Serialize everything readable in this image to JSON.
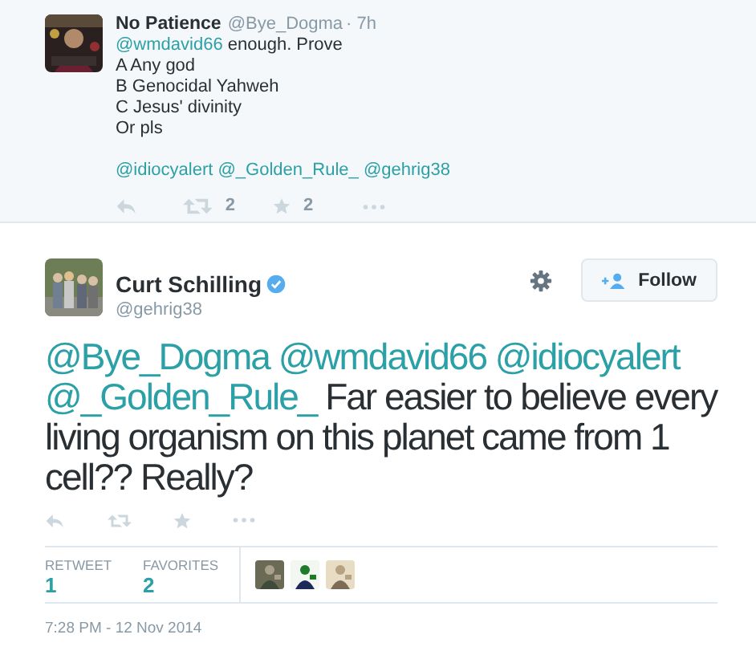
{
  "reply_tweet": {
    "name": "No Patience",
    "handle": "@Bye_Dogma",
    "time": "· 7h",
    "paragraphs": [
      [
        [
          {
            "kind": "mention",
            "text": "@wmdavid66"
          },
          {
            "kind": "text",
            "text": " enough. Prove"
          }
        ],
        [
          {
            "kind": "text",
            "text": "A Any god"
          }
        ],
        [
          {
            "kind": "text",
            "text": "B Genocidal Yahweh"
          }
        ],
        [
          {
            "kind": "text",
            "text": "C Jesus' divinity"
          }
        ],
        [
          {
            "kind": "text",
            "text": "Or pls"
          }
        ]
      ],
      [
        [
          {
            "kind": "mention",
            "text": "@idiocyalert"
          },
          {
            "kind": "mention",
            "text": "@_Golden_Rule_"
          },
          {
            "kind": "mention",
            "text": "@gehrig38"
          }
        ]
      ]
    ],
    "retweets": "2",
    "favorites": "2"
  },
  "main_tweet": {
    "name": "Curt Schilling",
    "verified": true,
    "handle": "@gehrig38",
    "follow_label": "Follow",
    "segments": [
      {
        "kind": "mention",
        "text": "@Bye_Dogma"
      },
      {
        "kind": "mention",
        "text": "@wmdavid66"
      },
      {
        "kind": "mention",
        "text": "@idiocyalert"
      },
      {
        "kind": "mention",
        "text": "@_Golden_Rule_"
      },
      {
        "kind": "text",
        "text": " Far easier to believe every living organism on this planet came from 1 cell?? Really?"
      }
    ],
    "stats": [
      {
        "label": "RETWEET",
        "value": "1"
      },
      {
        "label": "FAVORITES",
        "value": "2"
      }
    ],
    "timestamp": "7:28 PM - 12 Nov 2014"
  }
}
